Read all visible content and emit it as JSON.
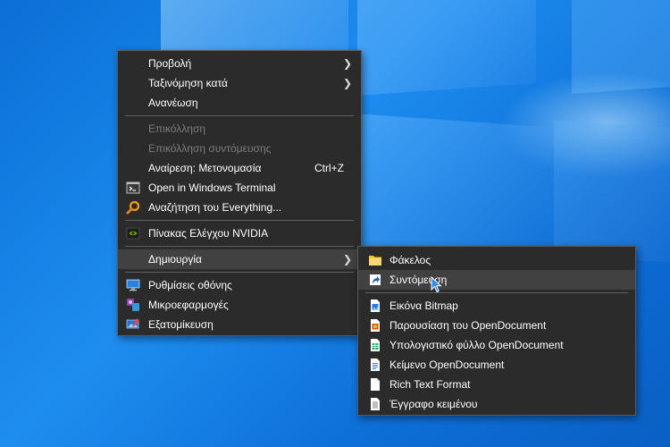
{
  "main_menu": {
    "items": [
      {
        "label": "Προβολή"
      },
      {
        "label": "Ταξινόμηση κατά"
      },
      {
        "label": "Ανανέωση"
      },
      {
        "label": "Επικόλληση"
      },
      {
        "label": "Επικόλληση συντόμευσης"
      },
      {
        "label": "Αναίρεση: Μετονομασία",
        "shortcut": "Ctrl+Z"
      },
      {
        "label": "Open in Windows Terminal"
      },
      {
        "label": "Αναζήτηση του Everything..."
      },
      {
        "label": "Πίνακας Ελέγχου NVIDIA"
      },
      {
        "label": "Δημιουργία"
      },
      {
        "label": "Ρυθμίσεις οθόνης"
      },
      {
        "label": "Μικροεφαρμογές"
      },
      {
        "label": "Εξατομίκευση"
      }
    ]
  },
  "sub_menu": {
    "items": [
      {
        "label": "Φάκελος"
      },
      {
        "label": "Συντόμευση"
      },
      {
        "label": "Εικόνα Bitmap"
      },
      {
        "label": "Παρουσίαση του OpenDocument"
      },
      {
        "label": "Υπολογιστικό φύλλο OpenDocument"
      },
      {
        "label": "Κείμενο OpenDocument"
      },
      {
        "label": "Rich Text Format"
      },
      {
        "label": "Έγγραφο κειμένου"
      }
    ]
  },
  "colors": {
    "menu_bg": "#2b2b2b",
    "highlight": "#414141",
    "disabled_text": "#7c7c7c",
    "desktop_blue": "#0d70d8"
  }
}
